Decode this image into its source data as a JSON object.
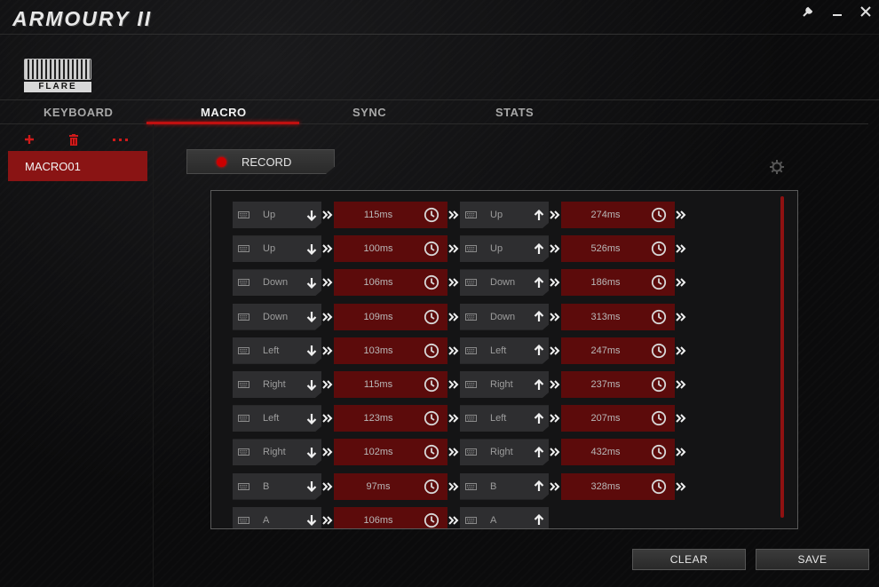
{
  "app": {
    "title": "ARMOURY II"
  },
  "device": {
    "brand": "FLARE"
  },
  "tabs": [
    {
      "label": "KEYBOARD",
      "active": false
    },
    {
      "label": "MACRO",
      "active": true
    },
    {
      "label": "SYNC",
      "active": false
    },
    {
      "label": "STATS",
      "active": false
    }
  ],
  "sidebar": {
    "actions": [
      "plus-icon",
      "trash-icon",
      "more-icon"
    ],
    "macros": [
      {
        "name": "MACRO01",
        "selected": true
      }
    ]
  },
  "record": {
    "label": "RECORD"
  },
  "macro_events": [
    {
      "key": "Up",
      "down_delay": "115ms",
      "up_delay": "274ms"
    },
    {
      "key": "Up",
      "down_delay": "100ms",
      "up_delay": "526ms"
    },
    {
      "key": "Down",
      "down_delay": "106ms",
      "up_delay": "186ms"
    },
    {
      "key": "Down",
      "down_delay": "109ms",
      "up_delay": "313ms"
    },
    {
      "key": "Left",
      "down_delay": "103ms",
      "up_delay": "247ms"
    },
    {
      "key": "Right",
      "down_delay": "115ms",
      "up_delay": "237ms"
    },
    {
      "key": "Left",
      "down_delay": "123ms",
      "up_delay": "207ms"
    },
    {
      "key": "Right",
      "down_delay": "102ms",
      "up_delay": "432ms"
    },
    {
      "key": "B",
      "down_delay": "97ms",
      "up_delay": "328ms"
    },
    {
      "key": "A",
      "down_delay": "106ms",
      "up_delay": null
    }
  ],
  "buttons": {
    "clear": "CLEAR",
    "save": "SAVE"
  },
  "colors": {
    "accent": "#c01010",
    "delay_bg": "#5c0b0b",
    "key_bg": "#2e2e30",
    "selected_macro": "#8a1414"
  }
}
